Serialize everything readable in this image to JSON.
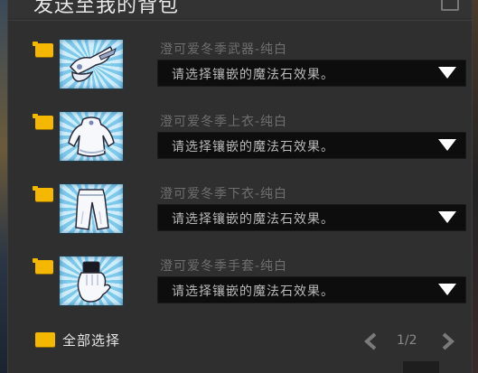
{
  "title": "发送至我的背包",
  "items": [
    {
      "name": "澄可爱冬季武器-纯白",
      "select_placeholder": "请选择镶嵌的魔法石效果。",
      "icon": "weapon-icon"
    },
    {
      "name": "澄可爱冬季上衣-纯白",
      "select_placeholder": "请选择镶嵌的魔法石效果。",
      "icon": "top-icon"
    },
    {
      "name": "澄可爱冬季下衣-纯白",
      "select_placeholder": "请选择镶嵌的魔法石效果。",
      "icon": "pants-icon"
    },
    {
      "name": "澄可爱冬季手套-纯白",
      "select_placeholder": "请选择镶嵌的魔法石效果。",
      "icon": "gloves-icon"
    }
  ],
  "footer": {
    "select_all_label": "全部选择",
    "page_indicator": "1/2"
  },
  "colors": {
    "checkbox": "#f5b800",
    "panel_bg": "#2f2f2f",
    "dropdown_bg": "#0d0d0d",
    "thumb_light": "#cfeefd",
    "thumb_dark": "#7ec8ea"
  }
}
